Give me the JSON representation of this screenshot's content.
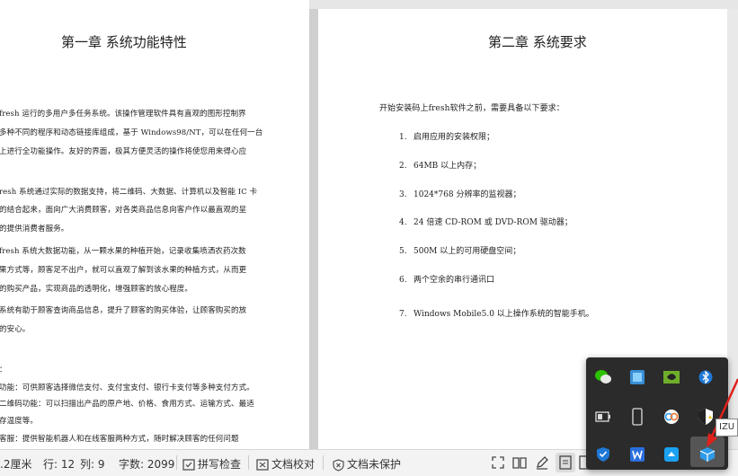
{
  "left_page": {
    "title": "第一章  系统功能特性",
    "lines": [
      "fresh 运行的多用户多任务系统。该操作管理软件具有直观的图形控制界",
      "多种不同的程序和动态链接库组成，基于 Windows98/NT，可以在任何一台",
      "上进行全功能操作。友好的界面，极其方便灵活的操作将使您用来得心应",
      "resh 系统通过实际的数据支持，将二维码、大数据、计算机以及智能 IC 卡",
      "的结合起来，面向广大消费顾客，对各类商品信息向客户作以最直观的呈",
      "的提供消费者服务。",
      "fresh 系统大数据功能，从一颗水果的种植开始，记录收集喷洒农药次数",
      "果方式等，顾客足不出户，就可以直观了解到该水果的种植方式，从而更",
      "的购买产品，实现商品的透明化，增强顾客的放心程度。",
      "系统有助于顾客查询商品信息，提升了顾客的购买体验，让顾客购买的放",
      "的安心。",
      "：",
      "功能：可供顾客选择微信支付、支付宝支付、银行卡支付等多种支付方式。",
      "二维码功能：可以扫描出产品的原产地、价格、食用方式、运输方式、最适",
      "存温度等。",
      "客服：提供智能机器人和在线客服两种方式，随时解决顾客的任何问题"
    ]
  },
  "right_page": {
    "title": "第二章  系统要求",
    "intro": "开始安装码上fresh软件之前，需要具备以下要求：",
    "requirements": [
      {
        "num": "1.",
        "text": "启用应用的安装权限；"
      },
      {
        "num": "2.",
        "text": "64MB 以上内存；"
      },
      {
        "num": "3.",
        "text": "1024*768 分辨率的监视器；"
      },
      {
        "num": "4.",
        "text": "24 倍速 CD-ROM 或 DVD-ROM 驱动器；"
      },
      {
        "num": "5.",
        "text": "500M 以上的可用硬盘空间；"
      },
      {
        "num": "6.",
        "text": "两个空余的串行通讯口"
      },
      {
        "num": "7.",
        "text": "Windows Mobile5.0 以上操作系统的智能手机。"
      }
    ]
  },
  "status_bar": {
    "position": ".2厘米",
    "row": "行: 12",
    "col": "列: 9",
    "word_count": "字数: 2099",
    "spell_check": "拼写检查",
    "doc_proof": "文档校对",
    "doc_protect": "文档未保护"
  },
  "tray": {
    "icons": [
      "wechat-icon",
      "app-blue-icon",
      "nvidia-icon",
      "bluetooth-icon",
      "battery-icon",
      "phone-icon",
      "baidu-netdisk-icon",
      "security-shield-icon",
      "defender-icon",
      "wps-icon",
      "cloud-icon",
      "selected-app-icon"
    ],
    "tooltip": "IZU"
  }
}
